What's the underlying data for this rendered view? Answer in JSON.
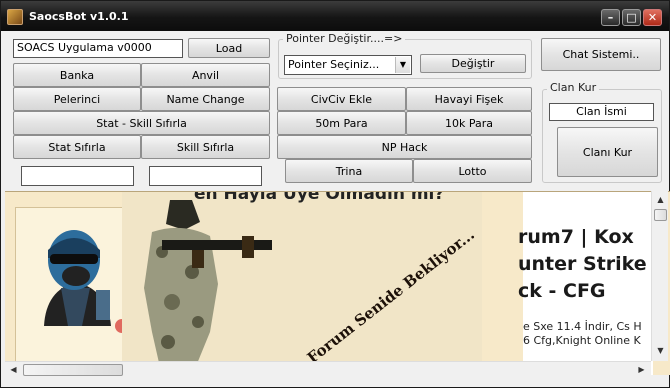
{
  "window": {
    "title": "SaocsBot v1.0.1"
  },
  "left": {
    "app_field": "SOACS Uygulama v0000",
    "load": "Load",
    "banka": "Banka",
    "anvil": "Anvil",
    "pelerinci": "Pelerinci",
    "name_change": "Name Change",
    "stat_skill_reset": "Stat - Skill Sıfırla",
    "stat_reset": "Stat Sıfırla",
    "skill_reset": "Skill Sıfırla",
    "field1": "",
    "field2": ""
  },
  "pointer": {
    "group_title": "Pointer Değiştir....=>",
    "select_value": "Pointer Seçiniz...",
    "change": "Değiştir"
  },
  "middle": {
    "civciv": "CivCiv Ekle",
    "fisek": "Havayi Fişek",
    "para50m": "50m Para",
    "para10k": "10k Para",
    "np_hack": "NP Hack",
    "trina": "Trina",
    "lotto": "Lotto"
  },
  "right": {
    "chat": "Chat Sistemi..",
    "clan_group": "Clan Kur",
    "clan_name": "Clan İsmi",
    "clan_create": "Clanı Kur"
  },
  "web": {
    "top_text": "en Hayla Üye Olmadın mı?",
    "diagonal_text": "a Forum Senide Bekliyor...",
    "forum_title": [
      "rum7 | Kox",
      "unter Strike",
      "ck - CFG"
    ],
    "forum_sub": [
      "e Sxe 11.4 İndir, Cs H",
      "6 Cfg,Knight Online K"
    ]
  }
}
